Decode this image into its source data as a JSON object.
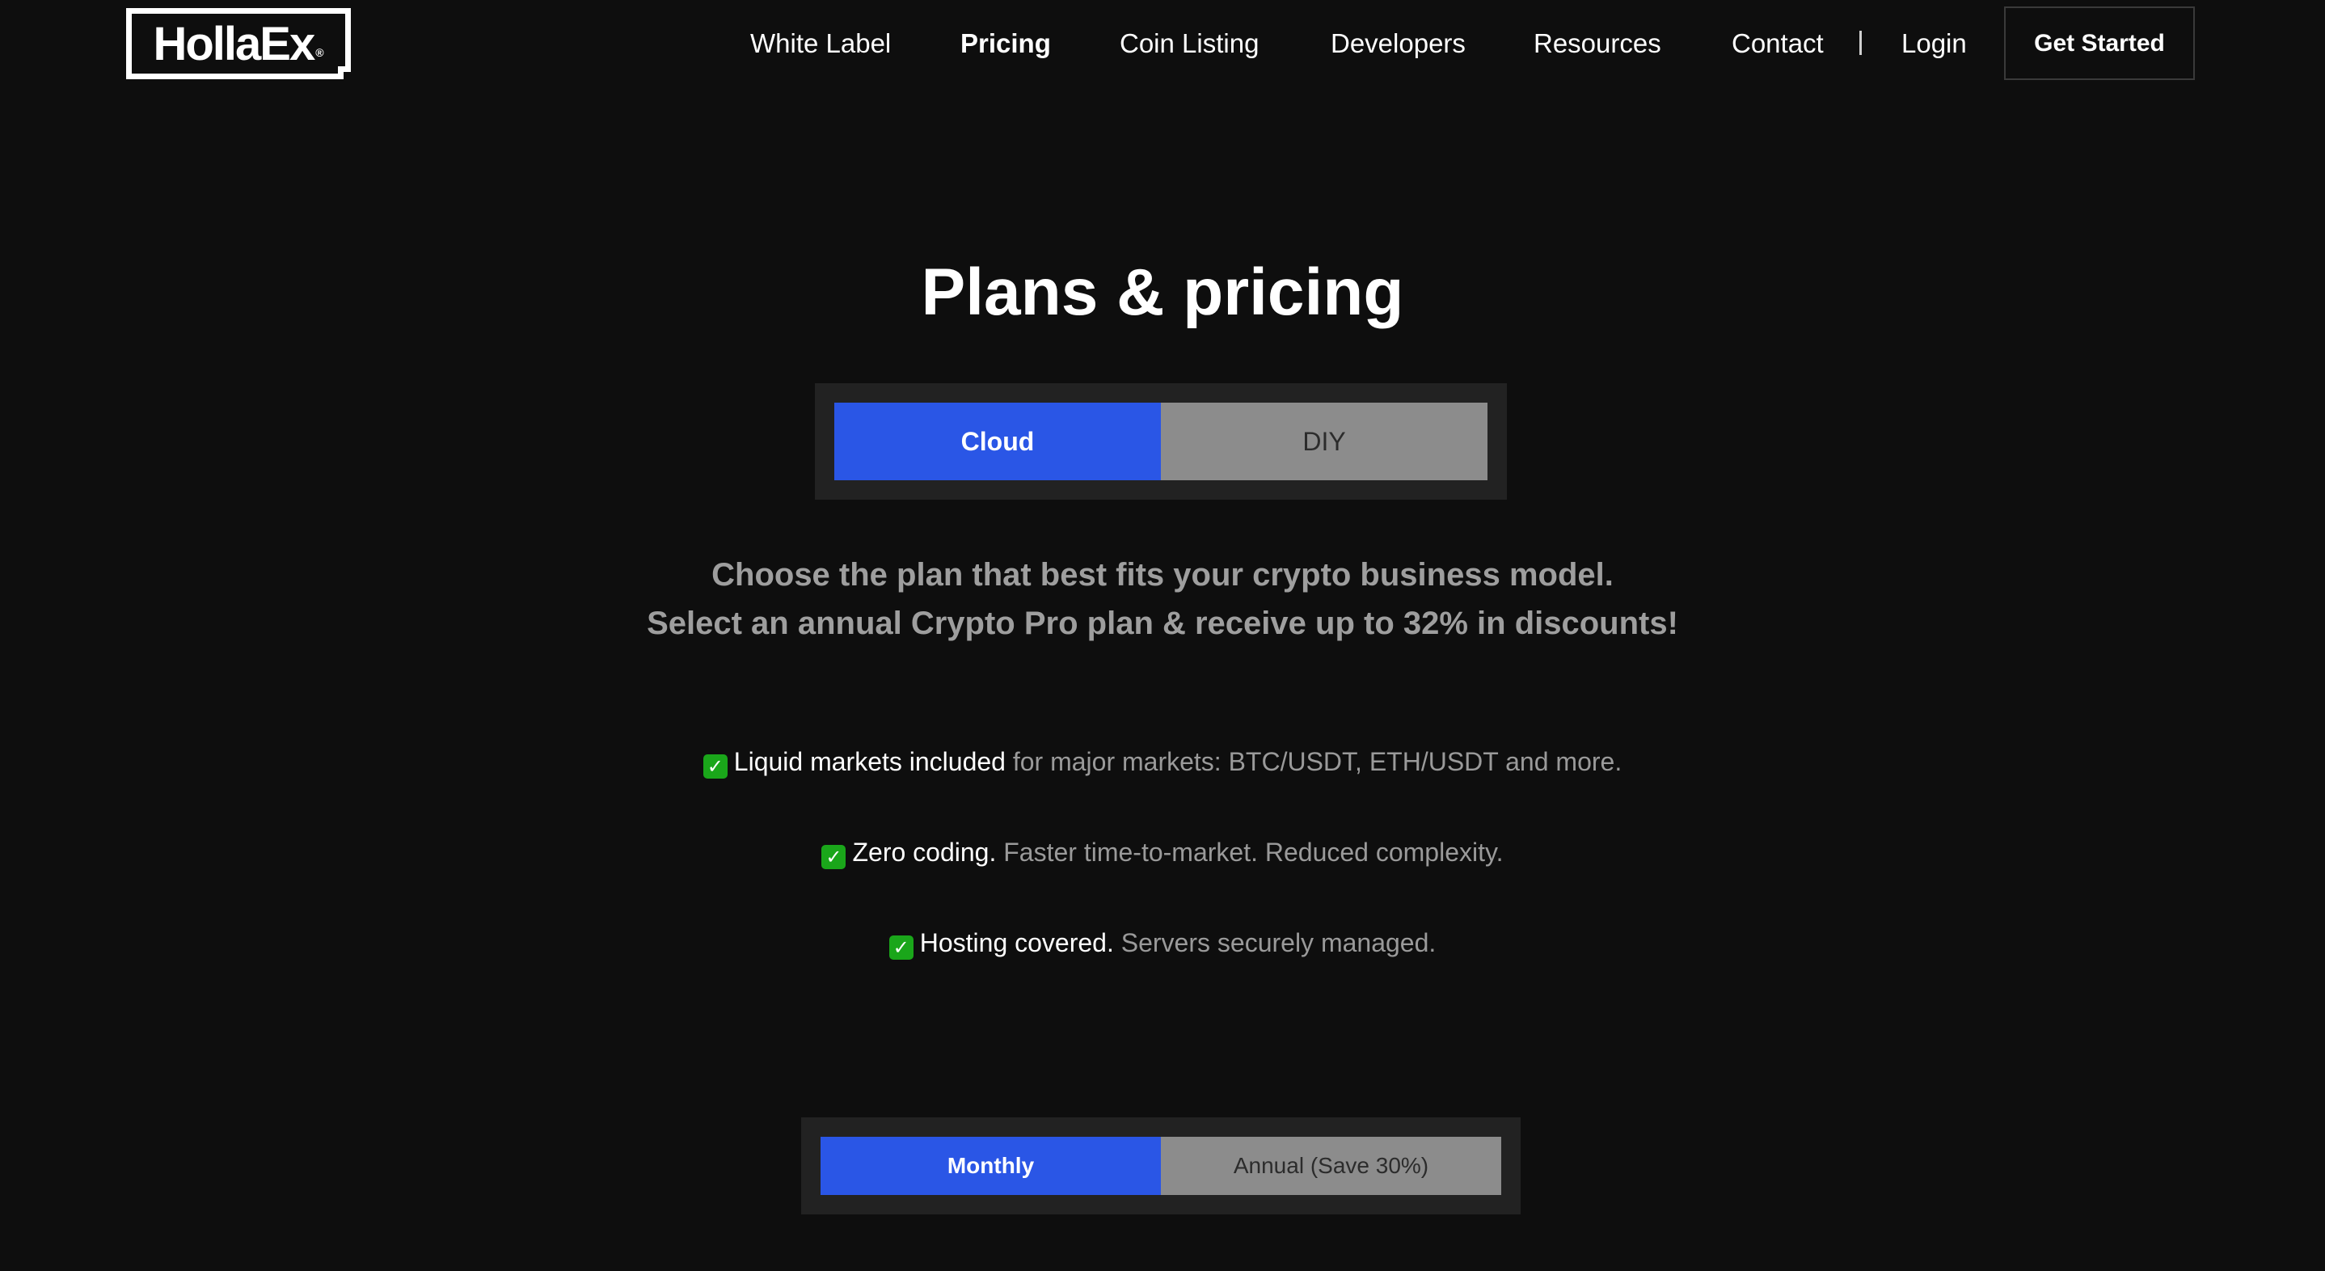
{
  "header": {
    "logo_text": "HollaEx",
    "logo_mark": "®",
    "nav": [
      {
        "label": "White Label",
        "active": false
      },
      {
        "label": "Pricing",
        "active": true
      },
      {
        "label": "Coin Listing",
        "active": false
      },
      {
        "label": "Developers",
        "active": false
      },
      {
        "label": "Resources",
        "active": false
      },
      {
        "label": "Contact",
        "active": false
      }
    ],
    "login_label": "Login",
    "cta_label": "Get Started"
  },
  "hero": {
    "title": "Plans & pricing",
    "product_toggle": {
      "options": [
        "Cloud",
        "DIY"
      ],
      "selected": "Cloud"
    },
    "subtitle_line1": "Choose the plan that best fits your crypto business model.",
    "subtitle_line2": "Select an annual Crypto Pro plan & receive up to 32% in discounts!"
  },
  "features": [
    {
      "icon": "check-icon",
      "strong": "Liquid markets included",
      "detail": " for major markets: BTC/USDT, ETH/USDT and more."
    },
    {
      "icon": "check-icon",
      "strong": "Zero coding.",
      "detail": " Faster time-to-market. Reduced complexity."
    },
    {
      "icon": "check-icon",
      "strong": "Hosting covered.",
      "detail": " Servers securely managed."
    }
  ],
  "billing_toggle": {
    "options": [
      "Monthly",
      "Annual (Save 30%)"
    ],
    "selected": "Monthly"
  },
  "colors": {
    "background": "#0e0e0e",
    "accent": "#2a56e6",
    "toggle_off": "#8c8c8c",
    "check": "#1aa61a",
    "muted_text": "#9e9e9e"
  }
}
